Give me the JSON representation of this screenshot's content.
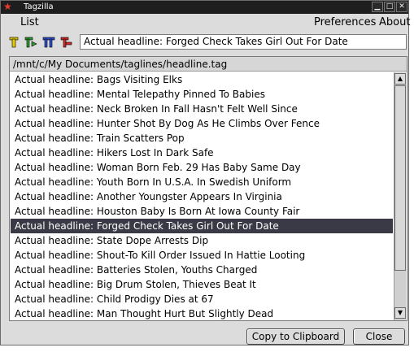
{
  "window": {
    "title": "Tagzilla"
  },
  "menubar": {
    "list": "List",
    "preferences": "Preferences",
    "about": "About"
  },
  "toolbar": {
    "icons": [
      "tag-yellow-icon",
      "tag-green-icon",
      "tag-blue-icon",
      "tag-red-icon"
    ],
    "headline_value": "Actual headline: Forged Check Takes Girl Out For Date"
  },
  "list": {
    "path": "/mnt/c/My Documents/taglines/headline.tag",
    "items": [
      "Actual headline: Bags Visiting Elks",
      "Actual headline: Mental Telepathy Pinned To Babies",
      "Actual headline: Neck Broken In Fall Hasn't Felt Well Since",
      "Actual headline: Hunter Shot By Dog As He Climbs Over Fence",
      "Actual headline: Train Scatters Pop",
      "Actual headline: Hikers Lost In Dark Safe",
      "Actual headline: Woman Born Feb. 29 Has Baby Same Day",
      "Actual headline: Youth Born In U.S.A. In Swedish Uniform",
      "Actual headline: Another Youngster Appears In Virginia",
      "Actual headline: Houston Baby Is Born At Iowa County Fair",
      "Actual headline: Forged Check Takes Girl Out For Date",
      "Actual headline: State Dope Arrests Dip",
      "Actual headline: Shout-To Kill Order Issued In Hattie Looting",
      "Actual headline: Batteries Stolen, Youths Charged",
      "Actual headline: Big Drum Stolen, Thieves Beat It",
      "Actual headline: Child Prodigy Dies at 67",
      "Actual headline: Man Thought Hurt But Slightly Dead"
    ],
    "selected_index": 10
  },
  "buttons": {
    "copy": "Copy to Clipboard",
    "close": "Close"
  },
  "colors": {
    "selection": "#3a3a46",
    "titlebar": "#1e1e1e"
  }
}
